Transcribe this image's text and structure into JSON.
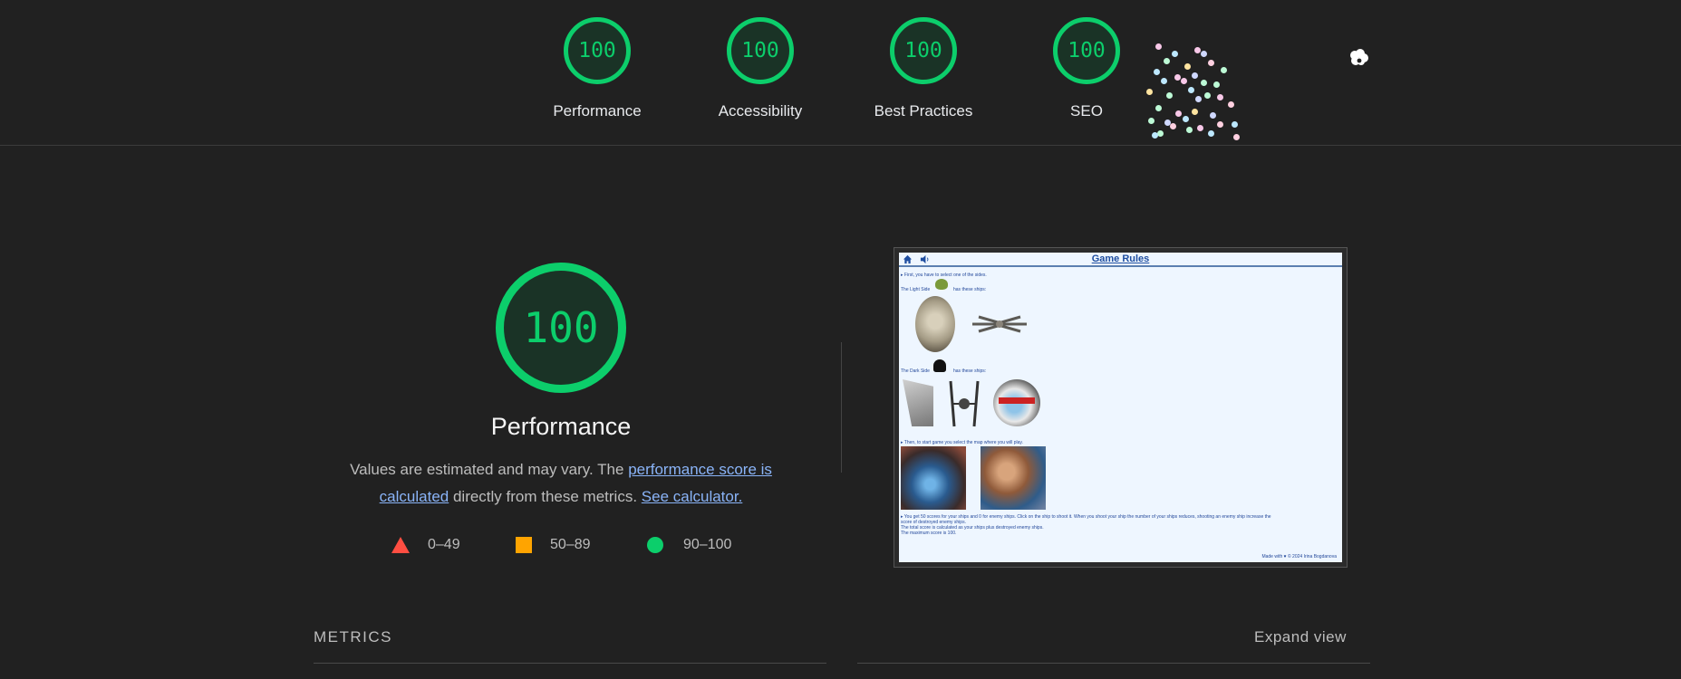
{
  "header": {
    "categories": [
      {
        "score": "100",
        "label": "Performance"
      },
      {
        "score": "100",
        "label": "Accessibility"
      },
      {
        "score": "100",
        "label": "Best Practices"
      },
      {
        "score": "100",
        "label": "SEO"
      }
    ]
  },
  "performance": {
    "score": "100",
    "title": "Performance",
    "desc_prefix": "Values are estimated and may vary. The ",
    "desc_link1": "performance score is calculated",
    "desc_middle": " directly from these metrics. ",
    "desc_link2": "See calculator.",
    "legend": {
      "fail": "0–49",
      "average": "50–89",
      "pass": "90–100"
    }
  },
  "thumbnail": {
    "title": "Game Rules",
    "line1": "▸ First, you have to select one of the sides.",
    "light_side": "The Light Side",
    "light_side_tail": "has these ships:",
    "dark_side": "The Dark Side",
    "dark_side_tail": "has these ships:",
    "map_line": "▸ Then, to start game you select the map where you will play.",
    "score_line1": "▸ You get 50 scores for your ships and 0 for enemy ships. Click on the ship to shoot it. When you shoot your ship the number of your ships reduces, shooting an enemy ship increase the",
    "score_line2": "score of destroyed enemy ships.",
    "score_line3": "The total score is calculated as your ships plus destroyed enemy ships.",
    "score_line4": "The maximum score is 100.",
    "footer": "Made with ♥ © 2024 Irina Bogdanova"
  },
  "metrics": {
    "label": "METRICS",
    "expand": "Expand view"
  },
  "colors": {
    "pass": "#0cce6b",
    "average": "#ffa400",
    "fail": "#ff4e42",
    "link": "#8ab4f8",
    "background": "#212121"
  }
}
